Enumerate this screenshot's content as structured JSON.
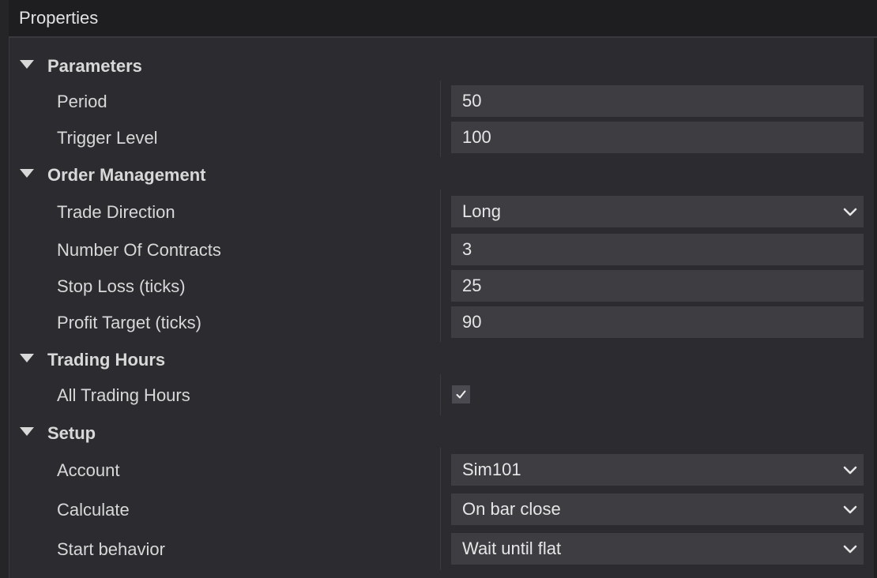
{
  "window": {
    "title": "Properties"
  },
  "categories": {
    "parameters": "Parameters",
    "order_management": "Order Management",
    "trading_hours": "Trading Hours",
    "setup": "Setup"
  },
  "properties": {
    "period": {
      "label": "Period",
      "value": "50"
    },
    "trigger_level": {
      "label": "Trigger Level",
      "value": "100"
    },
    "trade_direction": {
      "label": "Trade Direction",
      "value": "Long"
    },
    "number_of_contracts": {
      "label": "Number Of Contracts",
      "value": "3"
    },
    "stop_loss": {
      "label": "Stop Loss (ticks)",
      "value": "25"
    },
    "profit_target": {
      "label": "Profit Target (ticks)",
      "value": "90"
    },
    "all_trading_hours": {
      "label": "All Trading Hours",
      "checked": true
    },
    "account": {
      "label": "Account",
      "value": "Sim101"
    },
    "calculate": {
      "label": "Calculate",
      "value": "On bar close"
    },
    "start_behavior": {
      "label": "Start behavior",
      "value": "Wait until flat"
    }
  },
  "icons": {
    "category_toggle": "triangle-down-icon",
    "dropdown": "chevron-down-icon",
    "checkbox": "checkmark-icon"
  },
  "colors": {
    "background": "#2c2c30",
    "header_background": "#1e1e20",
    "field_background": "#3d3d42",
    "text": "#dcdcdc"
  }
}
